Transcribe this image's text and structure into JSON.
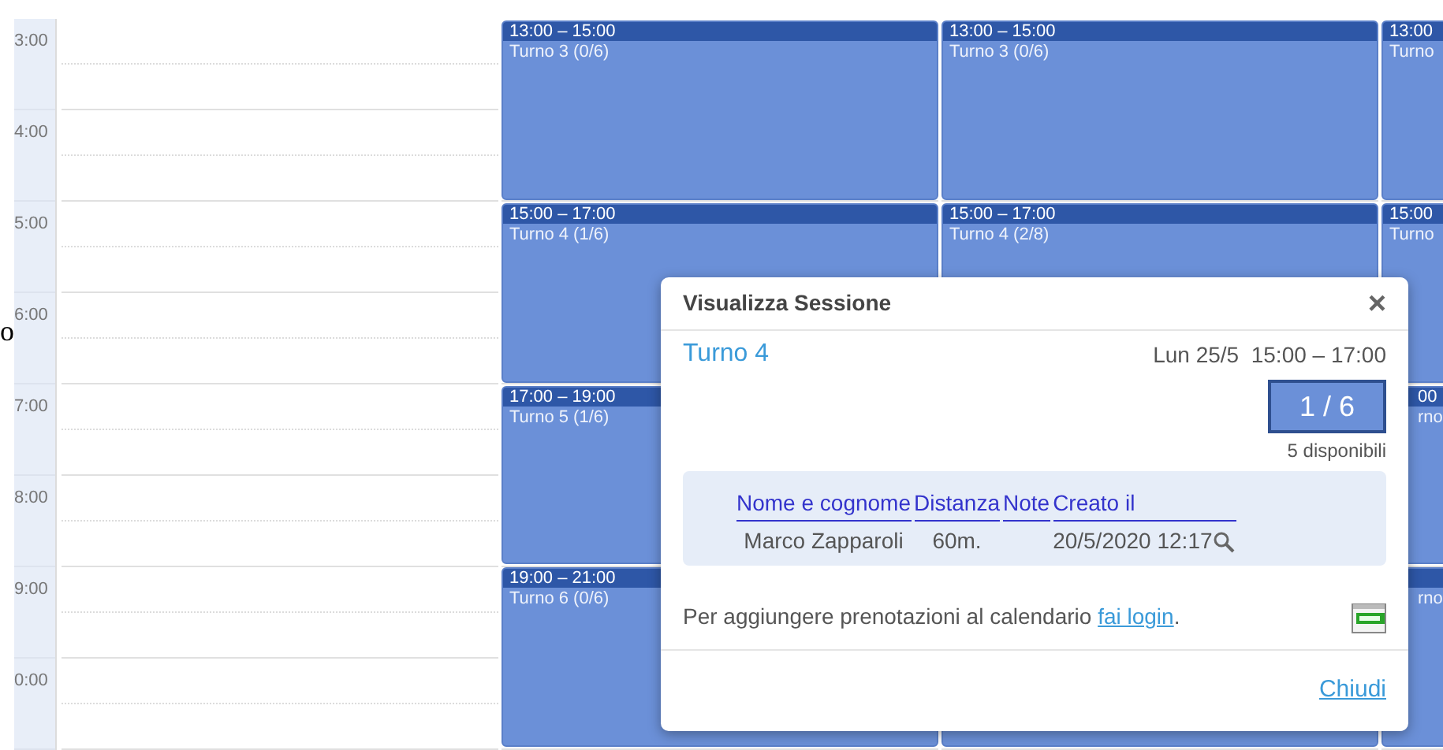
{
  "stray_text": "o",
  "time_labels": [
    "3:00",
    "4:00",
    "5:00",
    "6:00",
    "7:00",
    "8:00",
    "9:00",
    "0:00"
  ],
  "columns": [
    {},
    {
      "events": [
        {
          "kind": "event",
          "time": "13:00 – 15:00",
          "title": "Turno 3 (0/6)"
        },
        {
          "kind": "event",
          "time": "15:00 – 17:00",
          "title": "Turno 4 (1/6)"
        },
        {
          "kind": "event",
          "time": "17:00 – 19:00",
          "title": "Turno 5 (1/6)"
        },
        {
          "kind": "event",
          "time": "19:00 – 21:00",
          "title": "Turno 6 (0/6)"
        }
      ]
    },
    {
      "events": [
        {
          "kind": "event",
          "time": "13:00 – 15:00",
          "title": "Turno 3 (0/6)"
        },
        {
          "kind": "event",
          "time": "15:00 – 17:00",
          "title": "Turno 4 (2/8)"
        },
        {
          "kind": "gap"
        },
        {
          "kind": "event"
        }
      ]
    },
    {
      "events": [
        {
          "kind": "event",
          "time": "13:00",
          "title": "Turno"
        },
        {
          "kind": "event",
          "time": "15:00",
          "title": "Turno"
        },
        {
          "kind": "event",
          "time": "00",
          "title": "rno",
          "covered": true
        },
        {
          "kind": "event",
          "title": "rno",
          "covered": true
        }
      ]
    }
  ],
  "dialog": {
    "title": "Visualizza Sessione",
    "close": "×",
    "session": "Turno 4",
    "when": "Lun 25/5  15:00 – 17:00",
    "count": "1 / 6",
    "available": "5 disponibili",
    "table": {
      "columns": [
        "Nome e cognome",
        "Distanza",
        "Note",
        "Creato il"
      ],
      "rows": [
        [
          "Marco Zapparoli",
          "60m.",
          "",
          "20/5/2020 12:17"
        ]
      ]
    },
    "notice": "Per aggiungere prenotazioni al calendario",
    "login_link": "fai login",
    "notice_end": ".",
    "close_link": "Chiudi"
  }
}
